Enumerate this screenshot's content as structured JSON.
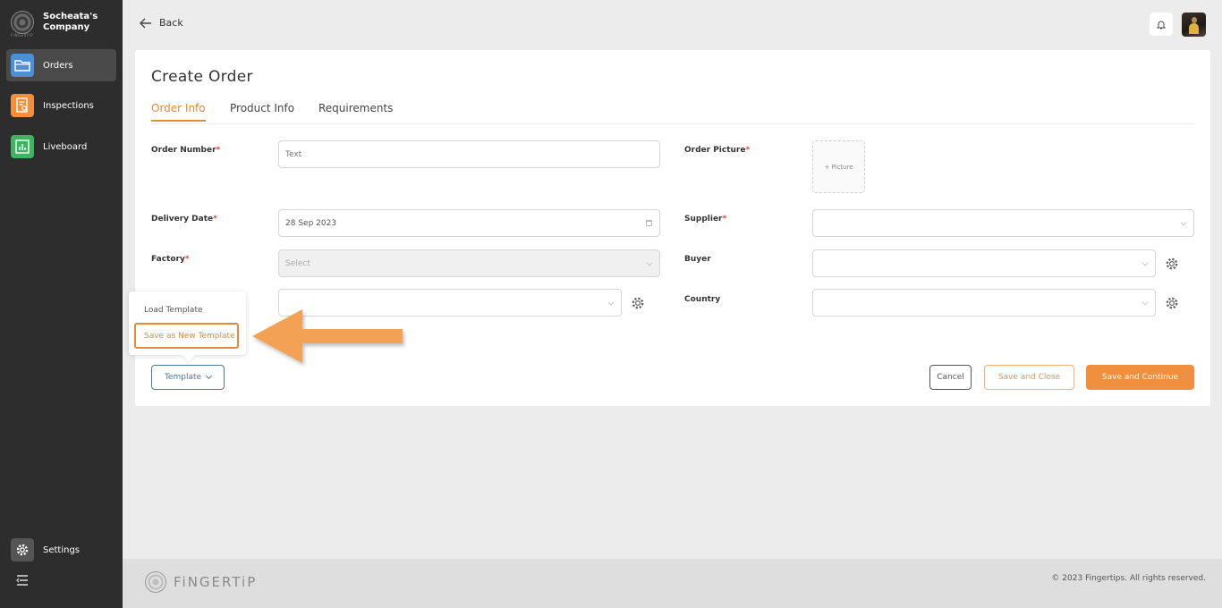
{
  "sidebar": {
    "company": "Socheata's Company",
    "logo_text": "FINGERTIP",
    "items": [
      {
        "label": "Orders",
        "icon": "folder-icon",
        "color": "#4a90d9",
        "active": true
      },
      {
        "label": "Inspections",
        "icon": "inspection-icon",
        "color": "#f08f3e",
        "active": false
      },
      {
        "label": "Liveboard",
        "icon": "chart-icon",
        "color": "#3fb463",
        "active": false
      }
    ],
    "settings_label": "Settings"
  },
  "header": {
    "back_label": "Back"
  },
  "page": {
    "title": "Create Order",
    "tabs": [
      {
        "label": "Order Info",
        "active": true
      },
      {
        "label": "Product Info",
        "active": false
      },
      {
        "label": "Requirements",
        "active": false
      }
    ]
  },
  "form": {
    "order_number": {
      "label": "Order Number",
      "placeholder": "Text",
      "value": ""
    },
    "order_picture": {
      "label": "Order Picture",
      "button": "+ Picture"
    },
    "delivery_date": {
      "label": "Delivery Date",
      "value": "28 Sep 2023"
    },
    "supplier": {
      "label": "Supplier",
      "value": ""
    },
    "factory": {
      "label": "Factory",
      "placeholder": "Select"
    },
    "buyer": {
      "label": "Buyer",
      "value": ""
    },
    "country": {
      "label": "Country",
      "value": ""
    },
    "required_mark": "*"
  },
  "buttons": {
    "template": "Template",
    "cancel": "Cancel",
    "save_close": "Save and Close",
    "save_continue": "Save and Continue"
  },
  "template_menu": {
    "items": [
      "Load Template",
      "Save as New Template"
    ],
    "highlighted": "Save as New Template"
  },
  "footer": {
    "brand": "FiNGERTiP",
    "copyright": "© 2023 Fingertips. All rights reserved."
  },
  "colors": {
    "accent": "#f08f3e",
    "sidebar": "#2d2d2d",
    "required": "#e0463c",
    "template_border": "#4a7a9a"
  }
}
